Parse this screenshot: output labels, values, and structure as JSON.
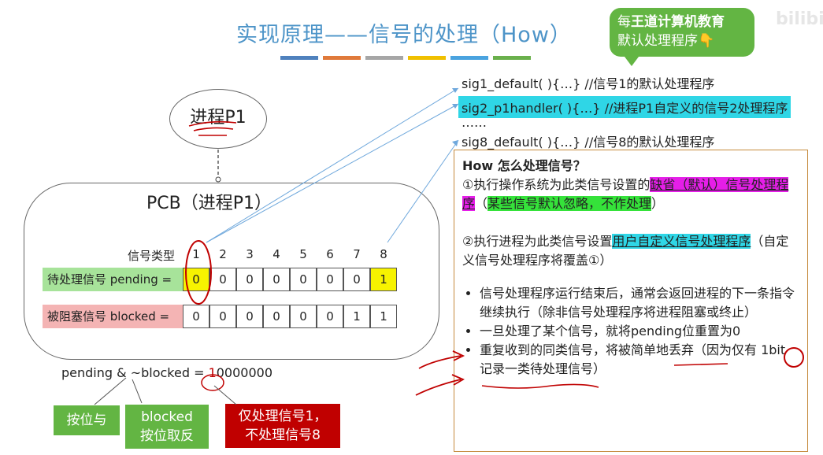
{
  "title": "实现原理——信号的处理（How）",
  "title_bar_colors": [
    "#4f81bd",
    "#e07a3a",
    "#a6a6a6",
    "#f0c000",
    "#4aa3df",
    "#6ab04c"
  ],
  "callout": {
    "line1_prefix": "每",
    "line1_brand": "王道计算机教育",
    "line2": "默认处理程序👇"
  },
  "watermark": "bilibili",
  "handlers": {
    "sig1": "sig1_default( ){…}    //信号1的默认处理程序",
    "sig2": "sig2_p1handler( ){…} //进程P1自定义的信号2处理程序",
    "dots": "……",
    "sig8": "sig8_default( ){…}   //信号8的默认处理程序"
  },
  "process_label": "进程P1",
  "pcb_label": "PCB（进程P1）",
  "table": {
    "type_label": "信号类型",
    "pending_label": "待处理信号 pending =",
    "blocked_label": "被阻塞信号 blocked =",
    "signal_numbers": [
      "1",
      "2",
      "3",
      "4",
      "5",
      "6",
      "7",
      "8"
    ],
    "pending_bits": [
      "0",
      "0",
      "0",
      "0",
      "0",
      "0",
      "0",
      "1"
    ],
    "blocked_bits": [
      "0",
      "0",
      "0",
      "0",
      "0",
      "0",
      "1",
      "1"
    ]
  },
  "formula": {
    "prefix": "pending & ~blocked = ",
    "first_bit": "1",
    "rest": "0000000"
  },
  "notes": {
    "and": "按位与",
    "not_line1": "blocked",
    "not_line2": "按位取反",
    "only_line1": "仅处理信号1，",
    "only_line2": "不处理信号8"
  },
  "how": {
    "question": "How 怎么处理信号？",
    "p1_a": "①执行操作系统为此类信号设置的",
    "p1_hl1": "缺省（默认）信号处理程序",
    "p1_b": "（",
    "p1_hl2": "某些信号默认忽略，不作处理",
    "p1_c": "）",
    "p2_a": "②执行进程为此类信号设置",
    "p2_hl": "用户自定义信号处理程序",
    "p2_b": "（自定义信号处理程序将覆盖①）",
    "bullets": [
      "信号处理程序运行结束后，通常会返回进程的下一条指令继续执行（除非信号处理程序将进程阻塞或终止）",
      "一旦处理了某个信号，就将pending位重置为0",
      "重复收到的同类信号，将被简单地丢弃（因为仅有 1bit 记录一类待处理信号）"
    ]
  }
}
